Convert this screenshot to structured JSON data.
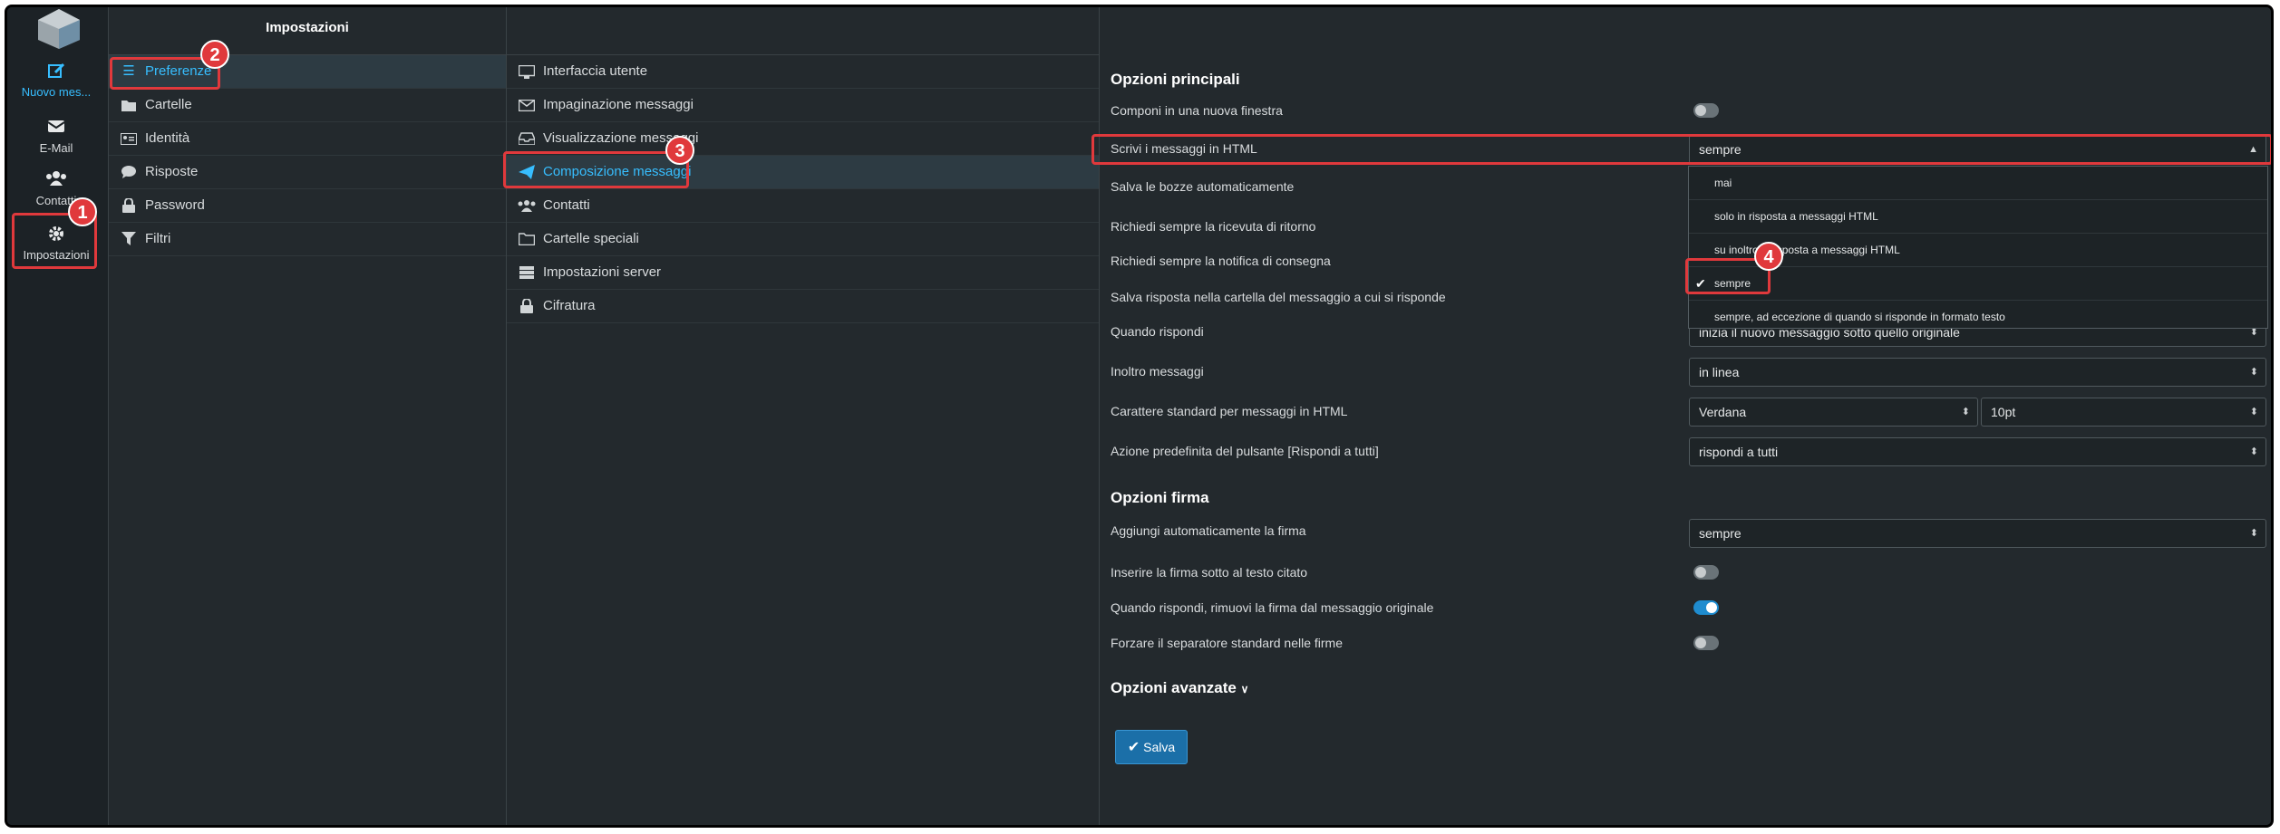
{
  "rail": {
    "items": [
      {
        "label": "Nuovo mes...",
        "icon": "compose-icon"
      },
      {
        "label": "E-Mail",
        "icon": "envelope-icon"
      },
      {
        "label": "Contatti",
        "icon": "contacts-icon"
      },
      {
        "label": "Impostazioni",
        "icon": "gear-icon"
      }
    ]
  },
  "settings": {
    "title": "Impostazioni",
    "items": [
      {
        "label": "Preferenze",
        "icon": "sliders-icon"
      },
      {
        "label": "Cartelle",
        "icon": "folder-icon"
      },
      {
        "label": "Identità",
        "icon": "id-card-icon"
      },
      {
        "label": "Risposte",
        "icon": "comment-icon"
      },
      {
        "label": "Password",
        "icon": "lock-icon"
      },
      {
        "label": "Filtri",
        "icon": "filter-icon"
      }
    ]
  },
  "sections": {
    "items": [
      {
        "label": "Interfaccia utente",
        "icon": "monitor-icon"
      },
      {
        "label": "Impaginazione messaggi",
        "icon": "envelope-icon"
      },
      {
        "label": "Visualizzazione messaggi",
        "icon": "inbox-icon"
      },
      {
        "label": "Composizione messaggi",
        "icon": "paper-plane-icon"
      },
      {
        "label": "Contatti",
        "icon": "contacts-icon"
      },
      {
        "label": "Cartelle speciali",
        "icon": "folder-open-icon"
      },
      {
        "label": "Impostazioni server",
        "icon": "server-icon"
      },
      {
        "label": "Cifratura",
        "icon": "lock-icon"
      }
    ]
  },
  "main": {
    "section1_title": "Opzioni principali",
    "rows": {
      "compose_new_window": "Componi in una nuova finestra",
      "write_html": "Scrivi i messaggi in HTML",
      "autosave_drafts": "Salva le bozze automaticamente",
      "request_receipt": "Richiedi sempre la ricevuta di ritorno",
      "request_delivery": "Richiedi sempre la notifica di consegna",
      "save_reply_folder": "Salva risposta nella cartella del messaggio a cui si risponde",
      "when_reply": "Quando rispondi",
      "forward": "Inoltro messaggi",
      "default_font": "Carattere standard per messaggi in HTML",
      "reply_all_action": "Azione predefinita del pulsante [Rispondi a tutti]"
    },
    "values": {
      "write_html": "sempre",
      "when_reply": "inizia il nuovo messaggio sotto quello originale",
      "forward": "in linea",
      "font_family": "Verdana",
      "font_size": "10pt",
      "reply_all_action": "rispondi a tutti"
    },
    "dropdown_options": [
      "mai",
      "solo in risposta a messaggi HTML",
      "su inoltro o risposta a messaggi HTML",
      "sempre",
      "sempre, ad eccezione di quando si risponde in formato testo"
    ],
    "section2_title": "Opzioni firma",
    "signature_rows": {
      "auto_add": "Aggiungi automaticamente la firma",
      "auto_add_value": "sempre",
      "below_quote": "Inserire la firma sotto al testo citato",
      "strip_on_reply": "Quando rispondi, rimuovi la firma dal messaggio originale",
      "force_separator": "Forzare il separatore standard nelle firme"
    },
    "toggles": {
      "compose_new_window": false,
      "below_quote": false,
      "strip_on_reply": true,
      "force_separator": false
    },
    "advanced_title": "Opzioni avanzate",
    "save_label": "Salva"
  },
  "annotations": [
    "1",
    "2",
    "3",
    "4"
  ],
  "colors": {
    "accent": "#37beff",
    "highlight": "#e0393c",
    "button": "#1b6fa8",
    "background": "#23292d"
  }
}
